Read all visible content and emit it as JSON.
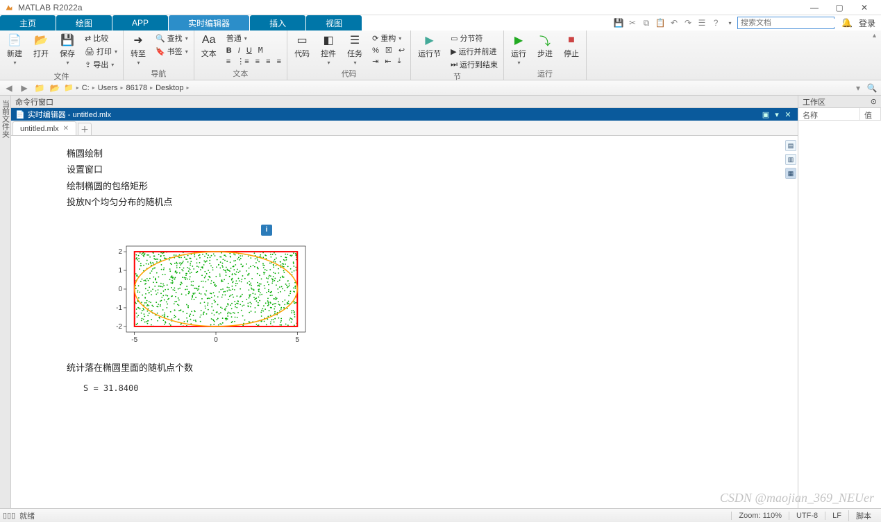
{
  "app": {
    "title": "MATLAB R2022a"
  },
  "win_btns": {
    "min": "—",
    "max": "▢",
    "close": "✕"
  },
  "tabs": {
    "home": "主页",
    "plot": "绘图",
    "app": "APP",
    "editor": "实时编辑器",
    "insert": "插入",
    "view": "视图"
  },
  "search": {
    "placeholder": "搜索文档",
    "login": "登录"
  },
  "toolstrip": {
    "file": {
      "new": "新建",
      "open": "打开",
      "save": "保存",
      "compare": "比较",
      "print": "打印",
      "export": "导出",
      "group": "文件"
    },
    "nav": {
      "goto": "转至",
      "find": "查找",
      "bookmark": "书签",
      "group": "导航"
    },
    "text": {
      "text": "文本",
      "normal": "普通",
      "group": "文本"
    },
    "code": {
      "code": "代码",
      "control": "控件",
      "task": "任务",
      "refactor": "重构",
      "group": "代码"
    },
    "section": {
      "runsection": "运行节",
      "step": "分节符",
      "runadvance": "运行并前进",
      "runtoend": "运行到结束",
      "group": "节"
    },
    "run": {
      "run": "运行",
      "step": "步进",
      "stop": "停止",
      "group": "运行"
    }
  },
  "address": {
    "segs": [
      "C:",
      "Users",
      "86178",
      "Desktop"
    ]
  },
  "left_gutter": "当前文件夹",
  "cmd_window": "命令行窗口",
  "dock": {
    "title": "实时编辑器 - untitled.mlx"
  },
  "doctab": {
    "name": "untitled.mlx"
  },
  "content": {
    "line1": "椭圆绘制",
    "line2": "设置窗口",
    "line3": "绘制椭圆的包络矩形",
    "line4": "投放N个均匀分布的随机点",
    "line5": "统计落在椭圆里面的随机点个数",
    "code": "S = 31.8400"
  },
  "workspace": {
    "title": "工作区",
    "col1": "名称",
    "col2": "值"
  },
  "status": {
    "ready": "就绪",
    "zoom": "Zoom: 110%",
    "enc": "UTF-8",
    "eol": "LF",
    "type": "脚本"
  },
  "watermark": "CSDN @maojian_369_NEUer",
  "chart_data": {
    "type": "scatter",
    "title": "",
    "xlabel": "",
    "ylabel": "",
    "xlim": [
      -5.5,
      5.5
    ],
    "ylim": [
      -2.3,
      2.3
    ],
    "xticks": [
      -5,
      0,
      5
    ],
    "yticks": [
      -2,
      -1,
      0,
      1,
      2
    ],
    "series": [
      {
        "name": "random-points",
        "kind": "scatter",
        "color": "#00aa00",
        "n": 1000,
        "x_range": [
          -5,
          5
        ],
        "y_range": [
          -2,
          2
        ]
      },
      {
        "name": "bounding-rect",
        "kind": "rect",
        "color": "#ff0000",
        "x0": -5,
        "y0": -2,
        "x1": 5,
        "y1": 2
      },
      {
        "name": "ellipse",
        "kind": "ellipse",
        "color": "#ffa000",
        "cx": 0,
        "cy": 0,
        "rx": 5,
        "ry": 2
      }
    ]
  }
}
